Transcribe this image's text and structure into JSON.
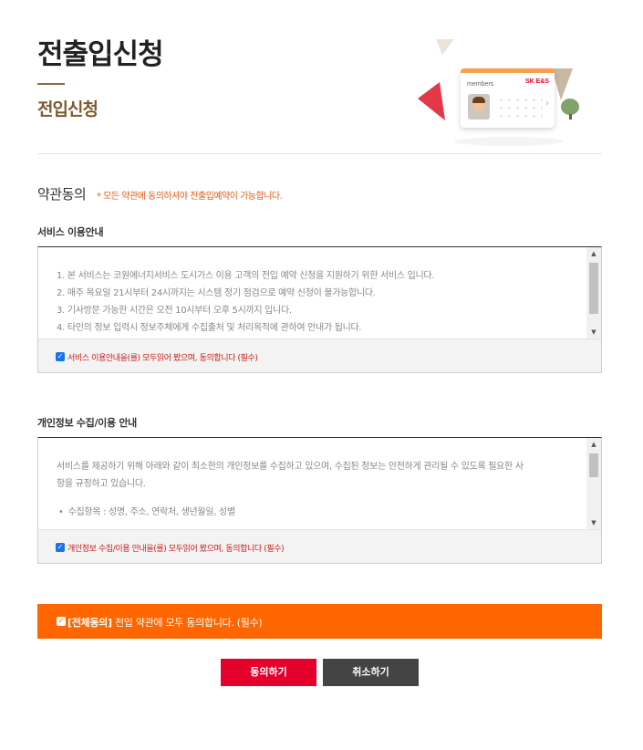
{
  "header": {
    "title": "전출입신청",
    "subtitle": "전입신청"
  },
  "illustration": {
    "card_label": "members",
    "card_brand": "SK E&S",
    "colors": {
      "stripe": "#f6a04d",
      "red_triangle": "#e4384a",
      "tan_triangle": "#b8a38a"
    }
  },
  "terms": {
    "heading": "약관동의",
    "notice": "* 모든 약관에 동의하셔야 전출입예약이 가능합니다."
  },
  "service": {
    "title": "서비스 이용안내",
    "lines": [
      "1. 본 서비스는 코원에너지서비스 도시가스 이용 고객의 전입 예약 신청을 지원하기 위한 서비스 입니다.",
      "2. 매주 목요일 21시부터 24시까지는 시스템 정기 점검으로 예약 신청이 불가능합니다.",
      "3. 기사방문 가능한 시간은 오전 10시부터 오후 5시까지 입니다.",
      "4. 타인의 정보 입력시 정보주체에게 수집출처 및 처리목적에 관하여 안내가 됩니다."
    ],
    "checkbox_label": "서비스 이용안내을(를) 모두읽어 봤으며, 동의합니다 (필수)",
    "checked": true
  },
  "privacy": {
    "title": "개인정보 수집/이용 안내",
    "intro_line1": "서비스를 제공하기 위해 아래와 같이 최소한의 개인정보를 수집하고 있으며, 수집된 정보는 안전하게 관리될 수 있도록 필요한 사",
    "intro_line2": "항을 규정하고 있습니다.",
    "item": "수집항목 : 성명, 주소, 연락처, 생년월일, 성별",
    "checkbox_label": "개인정보 수집/이용 안내을(를) 모두읽어 봤으며, 동의합니다 (필수)",
    "checked": true
  },
  "all_agree": {
    "label_bold": "[전체동의]",
    "label_rest": " 전입 약관에 모두 동의합니다. (필수)",
    "checked": true,
    "color": "#ff6600"
  },
  "buttons": {
    "agree": "동의하기",
    "cancel": "취소하기",
    "agree_color": "#e4002b",
    "cancel_color": "#444444"
  }
}
